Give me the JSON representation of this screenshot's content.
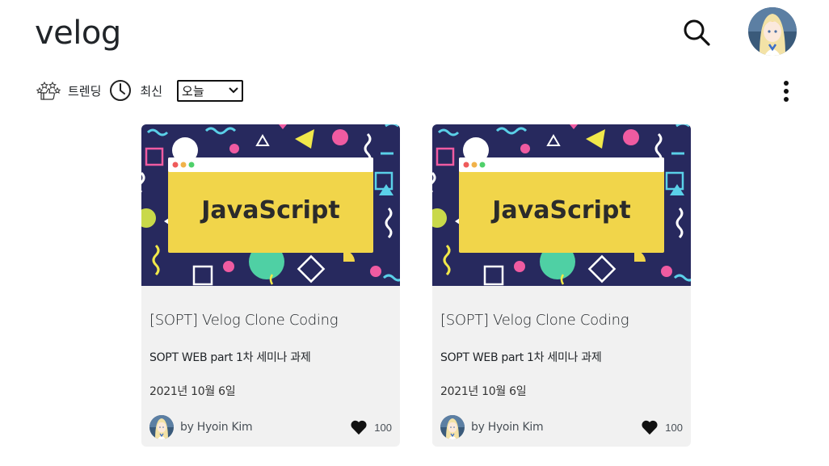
{
  "header": {
    "logo": "velog",
    "search_icon": "search-icon",
    "avatar_icon": "profile-avatar"
  },
  "filters": {
    "trending_label": "트렌딩",
    "recent_label": "최신",
    "period_selected": "오늘",
    "more_icon": "more-vertical-icon"
  },
  "posts": [
    {
      "thumbnail_text": "JavaScript",
      "title": "[SOPT] Velog Clone Coding",
      "description": "SOPT WEB part 1차 세미나 과제",
      "date": "2021년 10월 6일",
      "author": "by Hyoin Kim",
      "likes": "100"
    },
    {
      "thumbnail_text": "JavaScript",
      "title": "[SOPT] Velog Clone Coding",
      "description": "SOPT WEB part 1차 세미나 과제",
      "date": "2021년 10월 6일",
      "author": "by Hyoin Kim",
      "likes": "100"
    }
  ],
  "colors": {
    "thumbnail_bg": "#2a2a62",
    "banner_yellow": "#f1d54a",
    "text": "#212529",
    "card_bg": "#f1f1f1"
  }
}
